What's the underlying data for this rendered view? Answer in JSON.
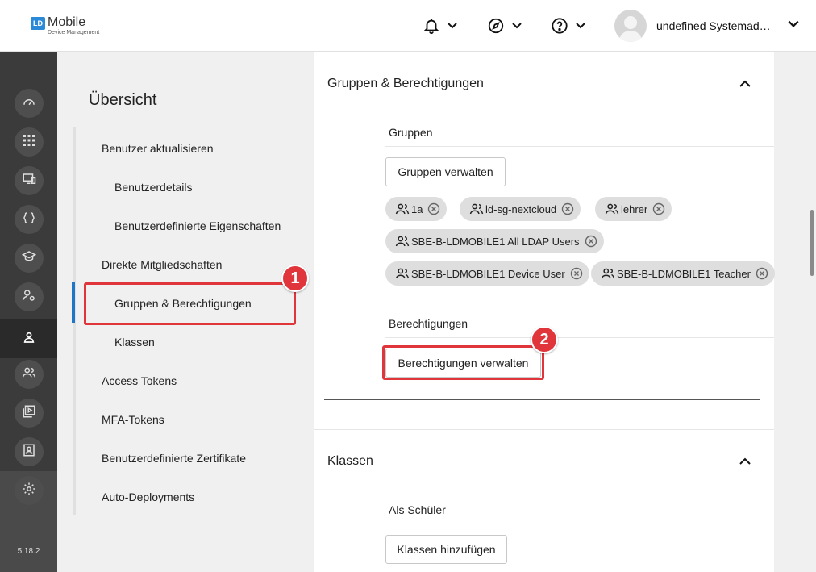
{
  "header": {
    "logo_mark": "LD",
    "logo_main": "Mobile",
    "logo_sub": "Device Management",
    "user_name": "undefined Systemadmi..."
  },
  "rail": {
    "version": "5.18.2",
    "icons": [
      "dashboard-icon",
      "apps-grid-icon",
      "device-star-icon",
      "code-braces-icon",
      "school-icon",
      "user-settings-icon",
      "user-icon",
      "users-icon",
      "media-icon",
      "badge-icon",
      "gear-icon"
    ]
  },
  "nav": {
    "title": "Übersicht",
    "items": [
      {
        "label": "Benutzer aktualisieren"
      },
      {
        "label": "Benutzerdetails"
      },
      {
        "label": "Benutzerdefinierte Eigenschaften"
      },
      {
        "label": "Direkte Mitgliedschaften"
      },
      {
        "label": "Gruppen & Berechtigungen"
      },
      {
        "label": "Klassen"
      },
      {
        "label": "Access Tokens"
      },
      {
        "label": "MFA-Tokens"
      },
      {
        "label": "Benutzerdefinierte Zertifikate"
      },
      {
        "label": "Auto-Deployments"
      }
    ]
  },
  "groups_section": {
    "title": "Gruppen & Berechtigungen",
    "groups_label": "Gruppen",
    "manage_groups_button": "Gruppen verwalten",
    "chips": [
      {
        "label": "1a"
      },
      {
        "label": "ld-sg-nextcloud"
      },
      {
        "label": "lehrer"
      },
      {
        "label": "SBE-B-LDMOBILE1 All LDAP Users"
      },
      {
        "label": "SBE-B-LDMOBILE1 Device User"
      },
      {
        "label": "SBE-B-LDMOBILE1 Teacher"
      }
    ],
    "permissions_label": "Berechtigungen",
    "manage_permissions_button": "Berechtigungen verwalten"
  },
  "classes_section": {
    "title": "Klassen",
    "student_label": "Als Schüler",
    "add_classes_button": "Klassen hinzufügen"
  },
  "annotations": {
    "badge1": "1",
    "badge2": "2",
    "color": "#e0353b"
  },
  "colors": {
    "accent": "#1f76c8",
    "rail": "#3b3b3b"
  }
}
